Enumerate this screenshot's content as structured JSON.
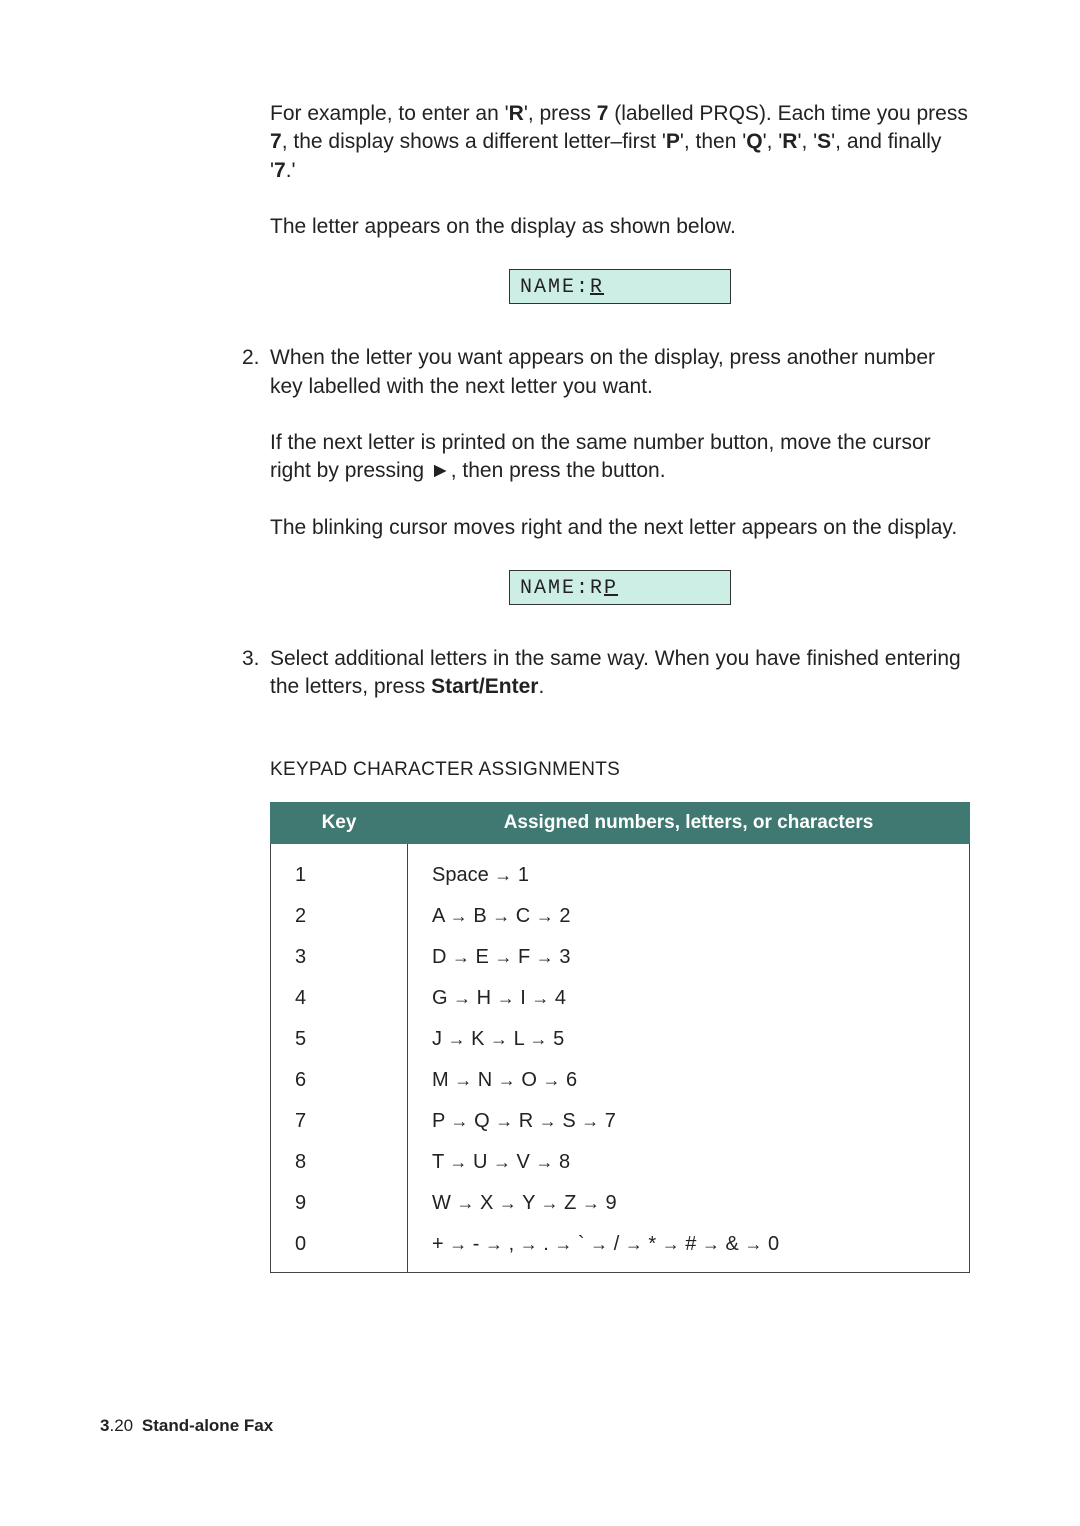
{
  "paragraphs": {
    "example_intro": "For example, to enter an '",
    "example_letter": "R",
    "example_mid1": "', press ",
    "example_key": "7",
    "example_mid2": " (labelled PRQS). Each time you press ",
    "example_mid3": ", the display shows a different letter–first '",
    "seq_P": "P",
    "example_mid4": "', then '",
    "seq_Q": "Q",
    "example_mid5": "', '",
    "seq_R": "R",
    "example_mid6": "', '",
    "seq_S": "S",
    "example_mid7": "', and finally '",
    "seq_7": "7",
    "example_end": ".'",
    "letter_appears": "The letter appears on the display as shown below.",
    "display1_prefix": "NAME:",
    "display1_cursor": "R",
    "step2_num": "2.",
    "step2_text": "When the letter you want appears on the display, press another number key labelled with the next letter you want.",
    "step2b_a": "If the next letter is printed on the same number button, move the cursor right by pressing ",
    "arrow_icon": "►",
    "step2b_b": ", then press the button.",
    "step2c": "The blinking cursor moves right and the next letter appears on the display.",
    "display2_prefix": "NAME:R",
    "display2_cursor": "P",
    "step3_num": "3.",
    "step3_a": "Select additional letters in the same way. When you have finished entering the letters, press ",
    "step3_key": "Start/Enter",
    "step3_b": "."
  },
  "section_title": "KEYPAD CHARACTER ASSIGNMENTS",
  "table": {
    "head_key": "Key",
    "head_assign": "Assigned numbers, letters, or characters",
    "rows": [
      {
        "key": "1",
        "seq": [
          "Space",
          "1"
        ]
      },
      {
        "key": "2",
        "seq": [
          "A",
          "B",
          "C",
          "2"
        ]
      },
      {
        "key": "3",
        "seq": [
          "D",
          "E",
          "F",
          "3"
        ]
      },
      {
        "key": "4",
        "seq": [
          "G",
          "H",
          "I",
          "4"
        ]
      },
      {
        "key": "5",
        "seq": [
          "J",
          "K",
          "L",
          "5"
        ]
      },
      {
        "key": "6",
        "seq": [
          "M",
          "N",
          "O",
          "6"
        ]
      },
      {
        "key": "7",
        "seq": [
          "P",
          "Q",
          "R",
          "S",
          "7"
        ]
      },
      {
        "key": "8",
        "seq": [
          "T",
          "U",
          "V",
          "8"
        ]
      },
      {
        "key": "9",
        "seq": [
          "W",
          "X",
          "Y",
          "Z",
          "9"
        ]
      },
      {
        "key": "0",
        "seq": [
          "+",
          "-",
          ",",
          ".",
          "`",
          "/",
          "*",
          "#",
          "&",
          "0"
        ]
      }
    ],
    "arrow": "→"
  },
  "footer": {
    "chapter": "3",
    "page_sep": ".",
    "page": "20",
    "title": "Stand-alone Fax"
  }
}
